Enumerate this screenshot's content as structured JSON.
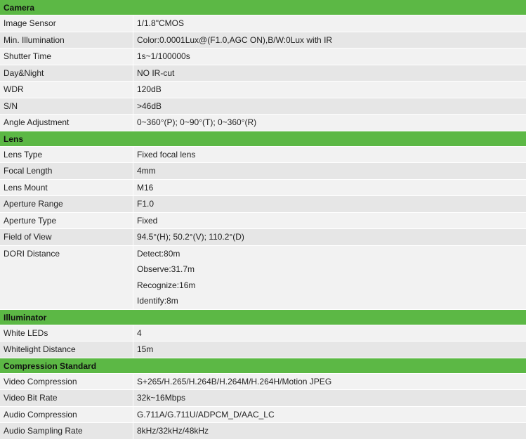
{
  "sections": [
    {
      "title": "Camera",
      "rows": [
        {
          "label": "Image Sensor",
          "values": [
            "1/1.8\"CMOS"
          ]
        },
        {
          "label": "Min. Illumination",
          "values": [
            "Color:0.0001Lux@(F1.0,AGC ON),B/W:0Lux with IR"
          ]
        },
        {
          "label": "Shutter Time",
          "values": [
            "1s~1/100000s"
          ]
        },
        {
          "label": "Day&Night",
          "values": [
            "NO IR-cut"
          ]
        },
        {
          "label": "WDR",
          "values": [
            "120dB"
          ]
        },
        {
          "label": "S/N",
          "values": [
            ">46dB"
          ]
        },
        {
          "label": "Angle Adjustment",
          "values": [
            "0~360°(P); 0~90°(T); 0~360°(R)"
          ]
        }
      ]
    },
    {
      "title": "Lens",
      "rows": [
        {
          "label": "Lens Type",
          "values": [
            "Fixed focal lens"
          ]
        },
        {
          "label": "Focal Length",
          "values": [
            "4mm"
          ]
        },
        {
          "label": "Lens Mount",
          "values": [
            "M16"
          ]
        },
        {
          "label": "Aperture Range",
          "values": [
            "F1.0"
          ]
        },
        {
          "label": "Aperture Type",
          "values": [
            "Fixed"
          ]
        },
        {
          "label": "Field of View",
          "values": [
            "94.5°(H); 50.2°(V); 110.2°(D)"
          ]
        },
        {
          "label": "DORI Distance",
          "values": [
            "Detect:80m",
            "Observe:31.7m",
            "Recognize:16m",
            "Identify:8m"
          ]
        }
      ]
    },
    {
      "title": "Illuminator",
      "rows": [
        {
          "label": "White LEDs",
          "values": [
            "4"
          ]
        },
        {
          "label": "Whitelight Distance",
          "values": [
            "15m"
          ]
        }
      ]
    },
    {
      "title": "Compression Standard",
      "rows": [
        {
          "label": "Video Compression",
          "values": [
            "S+265/H.265/H.264B/H.264M/H.264H/Motion JPEG"
          ]
        },
        {
          "label": "Video Bit Rate",
          "values": [
            "32k~16Mbps"
          ]
        },
        {
          "label": "Audio Compression",
          "values": [
            "G.711A/G.711U/ADPCM_D/AAC_LC"
          ]
        },
        {
          "label": "Audio Sampling Rate",
          "values": [
            "8kHz/32kHz/48kHz"
          ]
        }
      ]
    }
  ]
}
